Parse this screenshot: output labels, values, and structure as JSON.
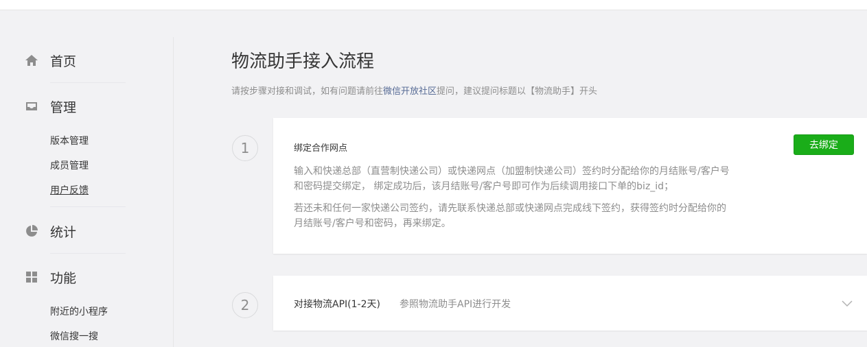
{
  "sidebar": {
    "groups": [
      {
        "label": "首页",
        "icon": "home-icon"
      },
      {
        "label": "管理",
        "icon": "inbox-icon",
        "items": [
          "版本管理",
          "成员管理",
          "用户反馈"
        ]
      },
      {
        "label": "统计",
        "icon": "pie-chart-icon"
      },
      {
        "label": "功能",
        "icon": "grid-icon",
        "items": [
          "附近的小程序",
          "微信搜一搜"
        ]
      }
    ],
    "active_item": "用户反馈"
  },
  "main": {
    "title": "物流助手接入流程",
    "hint": {
      "prefix": "请按步骤对接和调试，如有问题请前往",
      "link": "微信开放社区",
      "suffix": "提问，建议提问标题以【物流助手】开头"
    },
    "steps": [
      {
        "number": "1",
        "title": "绑定合作网点",
        "button": "去绑定",
        "desc1_line1": "输入和快递总部（直营制快递公司）或快递网点（加盟制快递公司）签约时分配给你的月结账号/客户号",
        "desc1_line2": "和密码提交绑定， 绑定成功后，该月结账号/客户号即可作为后续调用接口下单的biz_id；",
        "desc2_line1": "若还未和任何一家快递公司签约，请先联系快递总部或快递网点完成线下签约，获得签约时分配给你的",
        "desc2_line2": "月结账号/客户号和密码，再来绑定。"
      },
      {
        "number": "2",
        "title": "对接物流API(1-2天)",
        "desc": "参照物流助手API进行开发",
        "icon": "chevron-down-icon"
      }
    ]
  },
  "colors": {
    "accent_green": "#1aad19",
    "link_blue": "#576b95",
    "background": "#f2f2f4"
  }
}
